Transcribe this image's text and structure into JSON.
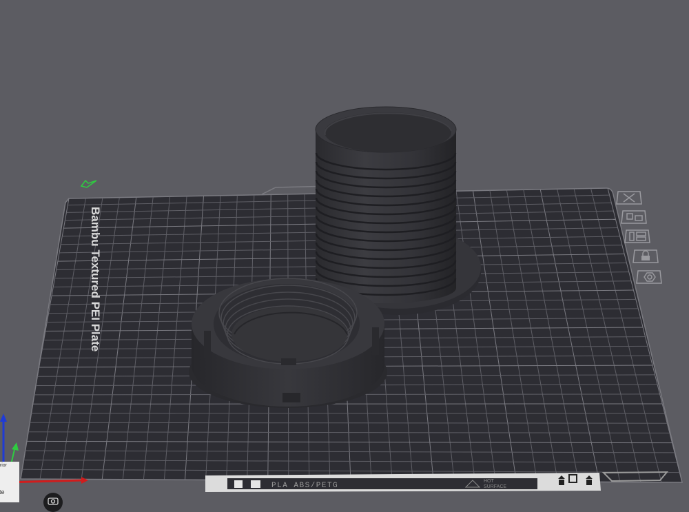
{
  "plate": {
    "name": "Bambu Textured PEI Plate",
    "filament_label": "PLA ABS/PETG",
    "surface_label_line1": "HOT",
    "surface_label_line2": "SURFACE"
  },
  "plate_tools": [
    {
      "name": "remove-plate-icon"
    },
    {
      "name": "arrange-icon"
    },
    {
      "name": "orient-icon"
    },
    {
      "name": "lock-icon"
    },
    {
      "name": "settings-icon"
    }
  ],
  "axis_colors": {
    "x": "#d11c1c",
    "y": "#2ecc40",
    "z": "#1f3bd6"
  },
  "overlay": {
    "line1": "erior",
    "line2": "nte"
  },
  "colors": {
    "background": "#5c5c62",
    "plate": "#2d2d33",
    "grid": "#6e6e74",
    "model": "#333338"
  }
}
